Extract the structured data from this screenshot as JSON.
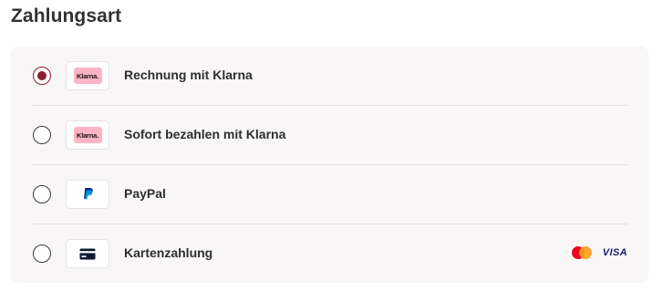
{
  "section": {
    "title": "Zahlungsart"
  },
  "payment_options": [
    {
      "label": "Rechnung mit Klarna",
      "selected": true,
      "icon": "klarna-logo",
      "badge_text": "Klarna."
    },
    {
      "label": "Sofort bezahlen mit Klarna",
      "selected": false,
      "icon": "klarna-logo",
      "badge_text": "Klarna."
    },
    {
      "label": "PayPal",
      "selected": false,
      "icon": "paypal-icon"
    },
    {
      "label": "Kartenzahlung",
      "selected": false,
      "icon": "credit-card-icon",
      "card_brands": [
        "mastercard",
        "VISA"
      ]
    }
  ],
  "colors": {
    "accent": "#8e1f33",
    "klarna_pink": "#ffb3c7",
    "panel_bg": "#f8f6f6",
    "paypal_dark": "#003087",
    "paypal_light": "#009cde"
  }
}
